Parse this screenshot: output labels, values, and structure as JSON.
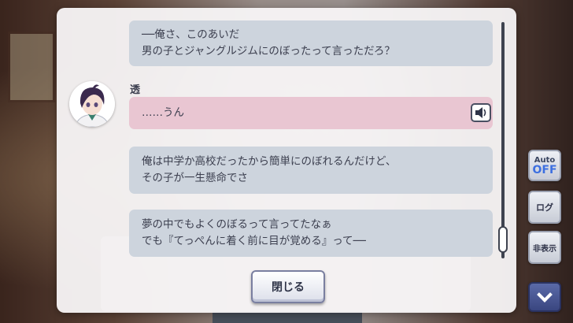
{
  "log": {
    "entries": [
      {
        "lines": [
          "──俺さ、このあいだ",
          "男の子とジャングルジムにのぼったって言っただろ？"
        ]
      },
      {
        "speaker": "透",
        "lines": [
          "……うん"
        ]
      },
      {
        "lines": [
          "俺は中学か高校だったから簡単にのぼれるんだけど、",
          "その子が一生懸命でさ"
        ]
      },
      {
        "lines": [
          "夢の中でもよくのぼるって言ってたなぁ",
          "でも『てっぺんに着く前に目が覚める』って──"
        ]
      }
    ],
    "close_label": "閉じる",
    "scroll_position_percent": 100
  },
  "side_controls": {
    "auto_label": "Auto",
    "auto_state": "OFF",
    "log_label": "ログ",
    "hide_label": "非表示"
  },
  "icons": {
    "voice": "speaker-icon",
    "scroll_down": "chevron-down-icon"
  },
  "colors": {
    "bubble_narration": "#cdd4dd",
    "bubble_speaker": "#e9c6d2",
    "auto_off": "#3d6fe0"
  }
}
